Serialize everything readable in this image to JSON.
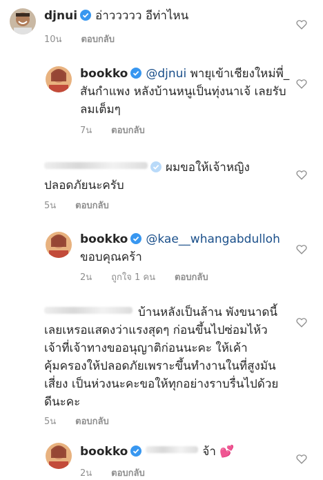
{
  "comments": [
    {
      "username": "djnui",
      "verified": true,
      "lines": [
        "อ่าววววว อีท่าไหน"
      ],
      "time": "10น",
      "likes": "",
      "reply_label": "ตอบกลับ"
    },
    {
      "username": "bookko",
      "verified": true,
      "mention": "@djnui",
      "lines": [
        "พายุเข้าเชียงใหม่พี่_",
        "สันกำแพง หลังบ้านหนูเป็นทุ่งนาเจ้ เลยรับ",
        "ลมเต็มๆ"
      ],
      "time": "7น",
      "likes": "",
      "reply_label": "ตอบกลับ"
    },
    {
      "username": "",
      "verified": true,
      "lines": [
        "ผมขอให้เจ้าหญิง",
        "ปลอดภัยนะครับ"
      ],
      "time": "5น",
      "likes": "",
      "reply_label": "ตอบกลับ"
    },
    {
      "username": "bookko",
      "verified": true,
      "mention": "@kae__whangabdulloh",
      "lines": [
        "ขอบคุณคร้า"
      ],
      "time": "2น",
      "likes": "ถูกใจ 1 คน",
      "reply_label": "ตอบกลับ"
    },
    {
      "username": "",
      "verified": false,
      "lines": [
        "บ้านหลังเป็นล้าน พังขนาดนี้",
        "เลยเหรอแสดงว่าแรงสุดๆ ก่อนขึ้นไปซ่อมไห้ว",
        "เจ้าที่เจ้าทางขออนุญาติก่อนนะคะ ให้เค้า",
        "คุ้มครองให้ปลอดภัยเพราะขึ้นทำงานในที่สูงมัน",
        "เสี่ยง เป็นห่วงนะคะขอให้ทุกอย่างราบรื่นไปด้วย",
        "ดีนะคะ"
      ],
      "time": "5น",
      "likes": "",
      "reply_label": "ตอบกลับ"
    },
    {
      "username": "bookko",
      "verified": true,
      "lines": [
        "จ้า 💕"
      ],
      "time": "2น",
      "likes": "",
      "reply_label": "ตอบกลับ"
    }
  ],
  "icons": {
    "heart": "heart-outline-icon",
    "verified": "verified-badge-icon"
  },
  "colors": {
    "text": "#262626",
    "secondary": "#8e8e8e",
    "verified": "#3897f0",
    "mention": "#1a4f8a"
  }
}
